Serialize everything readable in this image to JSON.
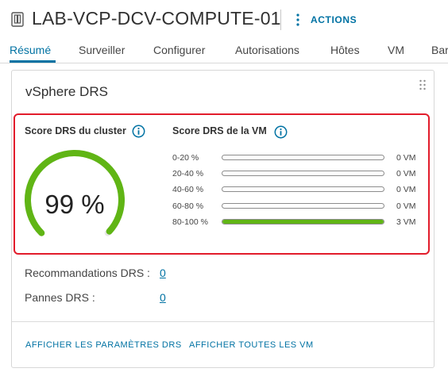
{
  "header": {
    "title": "LAB-VCP-DCV-COMPUTE-01",
    "icon": "cluster-icon",
    "actions_label": "ACTIONS"
  },
  "tabs": [
    {
      "label": "Résumé",
      "active": true
    },
    {
      "label": "Surveiller"
    },
    {
      "label": "Configurer"
    },
    {
      "label": "Autorisations"
    },
    {
      "label": "Hôtes"
    },
    {
      "label": "VM"
    },
    {
      "label": "Bar"
    }
  ],
  "card": {
    "title": "vSphere DRS",
    "cluster_score": {
      "label": "Score DRS du cluster",
      "value": "99 %",
      "percent": 99
    },
    "vm_score": {
      "label": "Score DRS de la VM",
      "rows": [
        {
          "range": "0-20 %",
          "count": "0 VM",
          "fill": 0
        },
        {
          "range": "20-40 %",
          "count": "0 VM",
          "fill": 0
        },
        {
          "range": "40-60 %",
          "count": "0 VM",
          "fill": 0
        },
        {
          "range": "60-80 %",
          "count": "0 VM",
          "fill": 0
        },
        {
          "range": "80-100 %",
          "count": "3 VM",
          "fill": 1
        }
      ]
    },
    "recommendations": {
      "label": "Recommandations DRS :",
      "value": "0"
    },
    "faults": {
      "label": "Pannes DRS :",
      "value": "0"
    },
    "footer": {
      "settings_link": "AFFICHER LES PARAMÈTRES DRS",
      "all_vms_link": "AFFICHER TOUTES LES VM"
    }
  },
  "colors": {
    "accent": "#0072a3",
    "gauge_green": "#60b515",
    "highlight_red": "#e21c2b"
  }
}
